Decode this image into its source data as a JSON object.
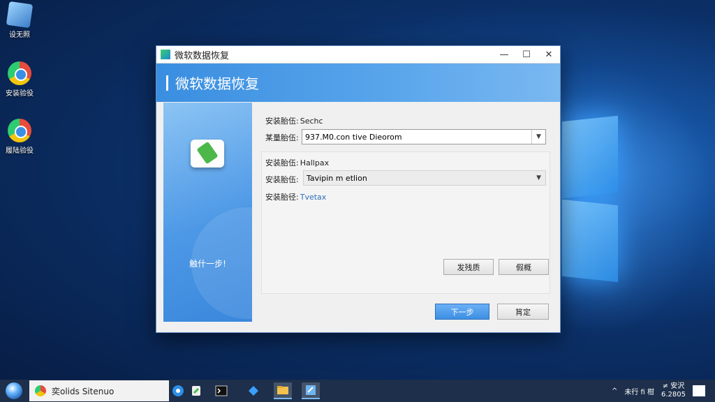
{
  "desktop": {
    "icons": [
      {
        "label": "设无照"
      },
      {
        "label": "安装验役"
      },
      {
        "label": "履陆验役"
      }
    ]
  },
  "window": {
    "title": "微软数据恢复",
    "controls": {
      "minimize": "—",
      "maximize": "☐",
      "close": "✕"
    },
    "banner_heading": "微软数据恢复",
    "sidebar": {
      "prev_label": "触什一步!"
    },
    "fields": {
      "row1_label": "安装胎伍:",
      "row1_value": "Sechc",
      "row2_label": "某量胎伍:",
      "row2_value": "937.M0.con tive Dieorom",
      "row3_label": "安装胎伍:",
      "row3_value": "Hallpax",
      "row4_label": "安装胎伍:",
      "row4_value": "Tavipin m etlion",
      "row5_label": "安装胎径:",
      "row5_value": "Tvetax"
    },
    "buttons": {
      "browse": "发残质",
      "modify": "假概",
      "next": "下一步",
      "confirm": "筲定"
    }
  },
  "taskbar": {
    "search_text": "奕olids Sitenuo",
    "tray_text": "未行 fi 柑",
    "clock_line1": "≠ 安沢",
    "clock_line2": "6.2805"
  },
  "colors": {
    "accent": "#3a8ee0",
    "primary_button": "#3d8fe3"
  }
}
